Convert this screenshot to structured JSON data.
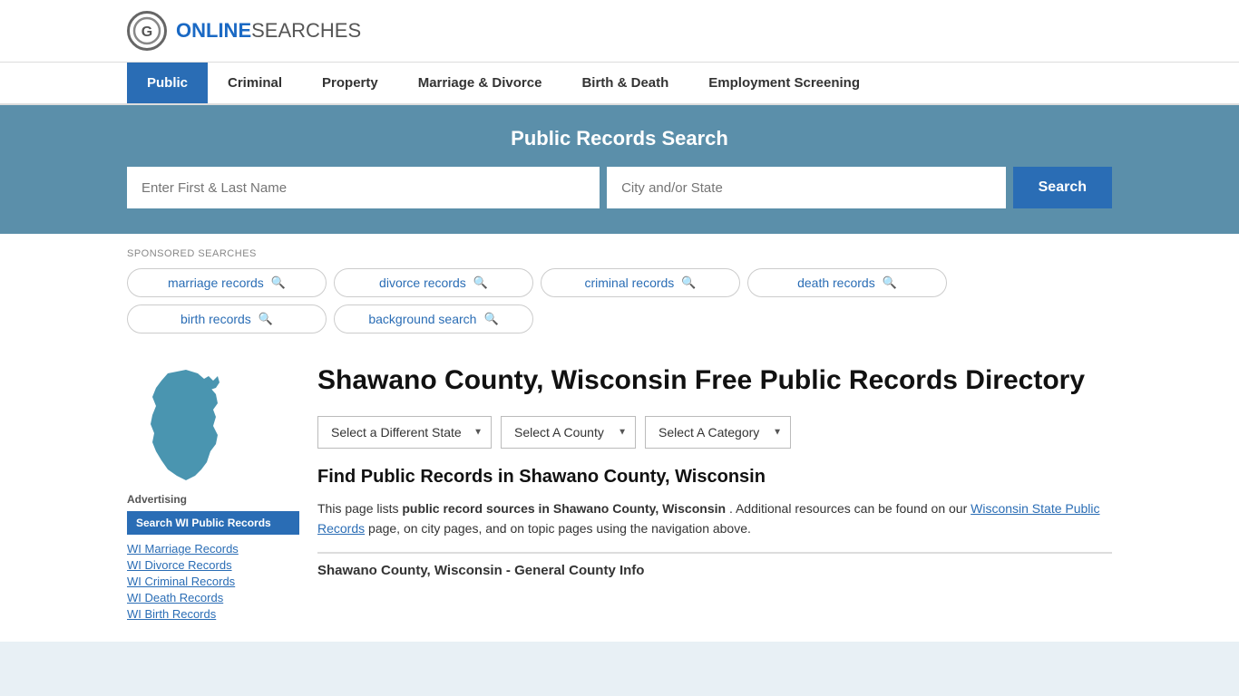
{
  "header": {
    "logo_letter": "G",
    "logo_bold": "ONLINE",
    "logo_light": "SEARCHES"
  },
  "nav": {
    "items": [
      {
        "label": "Public",
        "active": true
      },
      {
        "label": "Criminal",
        "active": false
      },
      {
        "label": "Property",
        "active": false
      },
      {
        "label": "Marriage & Divorce",
        "active": false
      },
      {
        "label": "Birth & Death",
        "active": false
      },
      {
        "label": "Employment Screening",
        "active": false
      }
    ]
  },
  "search_banner": {
    "title": "Public Records Search",
    "name_placeholder": "Enter First & Last Name",
    "location_placeholder": "City and/or State",
    "button_label": "Search"
  },
  "sponsored": {
    "label": "SPONSORED SEARCHES",
    "tags": [
      "marriage records",
      "divorce records",
      "criminal records",
      "death records",
      "birth records",
      "background search"
    ]
  },
  "page": {
    "title": "Shawano County, Wisconsin Free Public Records Directory",
    "dropdowns": {
      "state": "Select a Different State",
      "county": "Select A County",
      "category": "Select A Category"
    },
    "find_title": "Find Public Records in Shawano County, Wisconsin",
    "description_1": "This page lists ",
    "description_bold1": "public record sources in Shawano County, Wisconsin",
    "description_2": ". Additional resources can be found on our ",
    "description_link": "Wisconsin State Public Records",
    "description_3": " page, on city pages, and on topic pages using the navigation above.",
    "county_info_header": "Shawano County, Wisconsin - General County Info"
  },
  "sidebar": {
    "advertising_label": "Advertising",
    "ad_button": "Search WI Public Records",
    "links": [
      "WI Marriage Records",
      "WI Divorce Records",
      "WI Criminal Records",
      "WI Death Records",
      "WI Birth Records"
    ]
  }
}
